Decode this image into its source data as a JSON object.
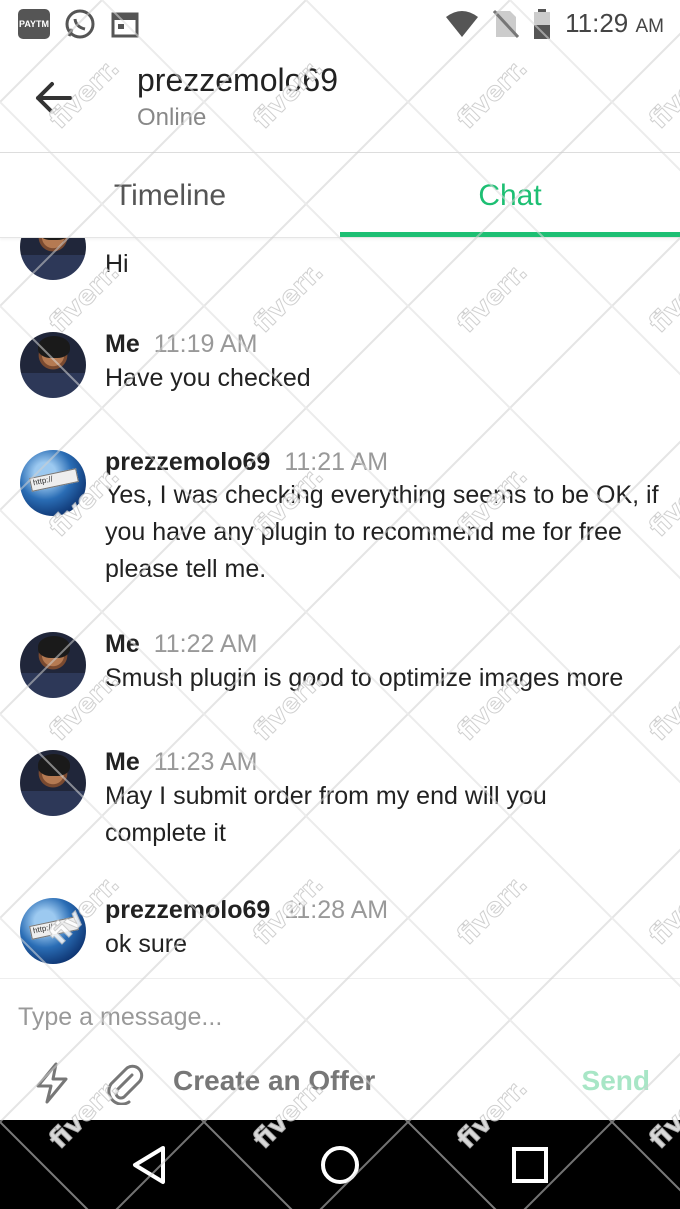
{
  "status_bar": {
    "paytm_label": "PAYTM",
    "time": "11:29",
    "ampm": "AM",
    "icons": [
      "paytm-icon",
      "whatsapp-icon",
      "calendar-icon",
      "wifi-icon",
      "no-sim-icon",
      "battery-icon"
    ]
  },
  "header": {
    "name": "prezzemolo69",
    "status": "Online"
  },
  "tabs": {
    "timeline": "Timeline",
    "chat": "Chat",
    "active": "chat"
  },
  "messages": [
    {
      "author": "",
      "time": "",
      "text": "Hi",
      "avatar": "me"
    },
    {
      "author": "Me",
      "time": "11:19 AM",
      "text": "Have you checked",
      "avatar": "me"
    },
    {
      "author": "prezzemolo69",
      "time": "11:21 AM",
      "text": "Yes, I was checking everything seems to be OK, if you have any plugin to recommend me for free please tell me.",
      "avatar": "globe"
    },
    {
      "author": "Me",
      "time": "11:22 AM",
      "text": "Smush plugin is good to optimize images more",
      "avatar": "me"
    },
    {
      "author": "Me",
      "time": "11:23 AM",
      "text": "May I submit order from my end will you complete it",
      "avatar": "me"
    },
    {
      "author": "prezzemolo69",
      "time": "11:28 AM",
      "text": "ok sure",
      "avatar": "globe"
    }
  ],
  "composer": {
    "placeholder": "Type a message...",
    "offer_label": "Create an Offer",
    "send_label": "Send"
  },
  "watermark_text": "fiverr.",
  "colors": {
    "accent": "#1dbf73",
    "send_disabled": "#a8e6c6",
    "navbar": "#000000"
  }
}
